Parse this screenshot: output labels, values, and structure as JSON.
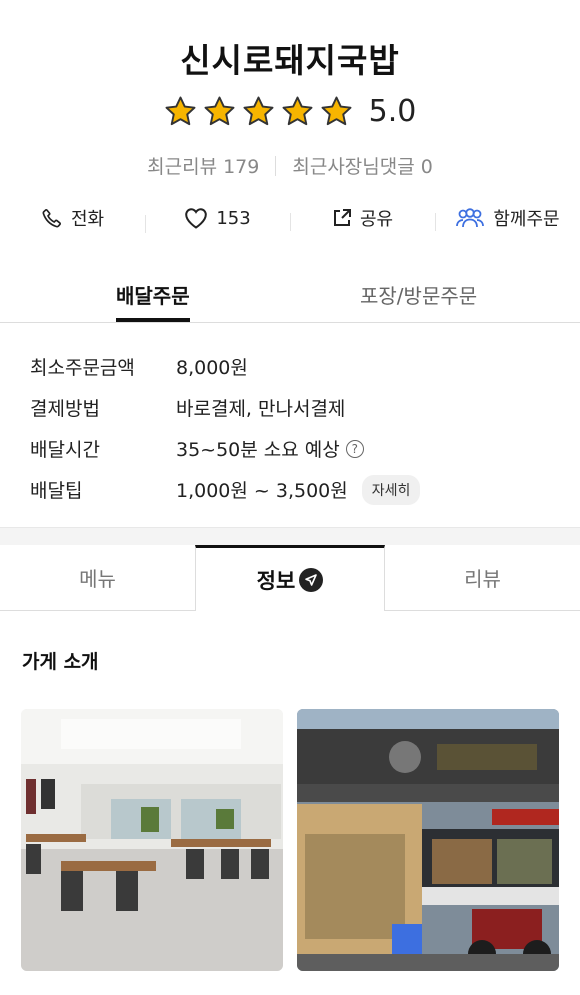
{
  "store": {
    "name": "신시로돼지국밥",
    "rating": "5.0",
    "rating_stars": 5,
    "recent_reviews": "최근리뷰 179",
    "owner_replies": "최근사장님댓글 0"
  },
  "actions": [
    {
      "label": "전화",
      "icon": "phone-icon"
    },
    {
      "label": "153",
      "icon": "heart-icon"
    },
    {
      "label": "공유",
      "icon": "share-icon"
    },
    {
      "label": "함께주문",
      "icon": "group-icon"
    }
  ],
  "order_tabs": {
    "delivery": "배달주문",
    "pickup": "포장/방문주문"
  },
  "delivery_info": [
    {
      "key": "최소주문금액",
      "value": "8,000원"
    },
    {
      "key": "결제방법",
      "value": "바로결제, 만나서결제"
    },
    {
      "key": "배달시간",
      "value": "35~50분 소요 예상"
    },
    {
      "key": "배달팁",
      "value": "1,000원 ~ 3,500원"
    }
  ],
  "help_icon": "?",
  "detail_button": "자세히",
  "content_tabs": {
    "menu": "메뉴",
    "info": "정보",
    "review": "리뷰"
  },
  "section": {
    "intro_title": "가게 소개"
  },
  "colors": {
    "star": "#F7B500",
    "accent_blue": "#3D6FE0",
    "text": "#222222"
  }
}
